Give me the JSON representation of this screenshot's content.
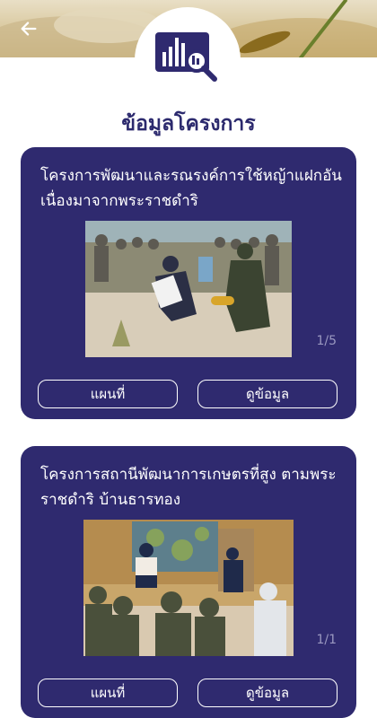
{
  "header": {
    "back_icon": "arrow-left-icon",
    "badge_icon": "chart-magnifier-icon"
  },
  "page": {
    "title": "ข้อมูลโครงการ"
  },
  "colors": {
    "card": "#2f2a6f",
    "title": "#2c2a6e",
    "counter": "#9a98c0"
  },
  "projects": [
    {
      "title": "โครงการพัฒนาและรณรงค์การใช้หญ้าแฝกอันเนื่องมาจากพระราชดำริ",
      "counter": "1/5",
      "map_label": "แผนที่",
      "details_label": "ดูข้อมูล"
    },
    {
      "title": "โครงการสถานีพัฒนาการเกษตรที่สูง ตามพระราชดำริ บ้านธารทอง",
      "counter": "1/1",
      "map_label": "แผนที่",
      "details_label": "ดูข้อมูล"
    }
  ]
}
